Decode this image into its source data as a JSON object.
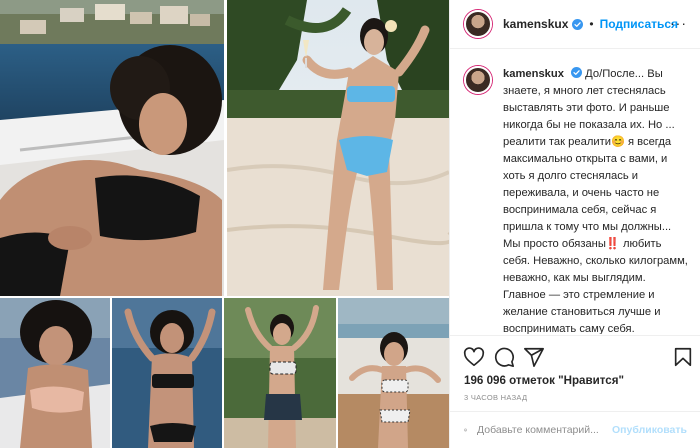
{
  "post": {
    "username": "kamenskux",
    "dot": "•",
    "follow_label": "Подписаться",
    "more_label": "···",
    "caption_text": "До/После... Вы знаете, я много лет стеснялась выставлять эти фото. И раньше никогда бы не показала их. Но ... реалити так реалити😊 я всегда максимально открыта с вами, и хоть я долго стеснялась и переживала, и очень часто не воспринимала себя, сейчас я пришла к тому что мы должны... Мы просто обязаны‼️ любить себя. Неважно, сколько килограмм, неважно, как мы выглядим. Главное — это стремление и желание становиться лучше и воспринимать саму себя. Становиться лучше и идти к принятию себя🙏 Не для других, не для комментариев, не для общественного мнения. А исключительно для самой себя. Я рада, что наконец-то я пришла к",
    "likes": "196 096 отметок \"Нравится\"",
    "time": "3 ЧАСОВ НАЗАД",
    "comment_placeholder": "Добавьте комментарий...",
    "post_label": "Опубликовать"
  },
  "colors": {
    "link_blue": "#0095f6",
    "post_disabled": "#b2dffc",
    "verified": "#3897f0",
    "muted": "#8e8e8e",
    "border": "#efefef"
  },
  "icons": [
    "verified-badge-icon",
    "heart-icon",
    "comment-icon",
    "share-icon",
    "bookmark-icon",
    "emoji-icon",
    "more-icon"
  ]
}
